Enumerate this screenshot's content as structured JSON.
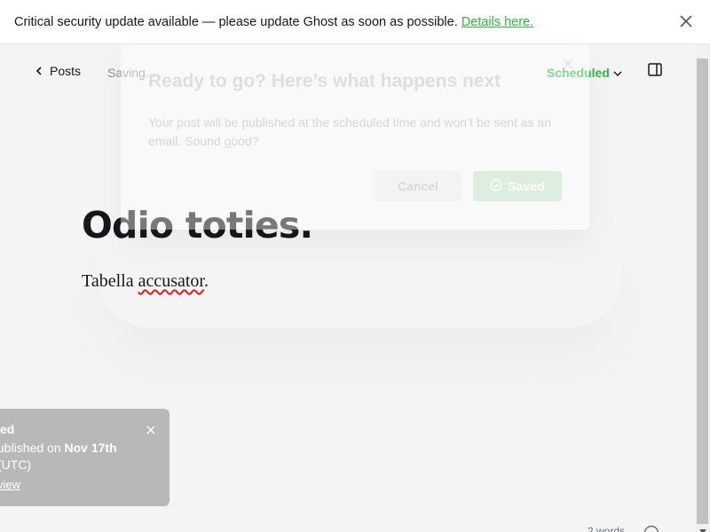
{
  "alert": {
    "message": "Critical security update available — please update Ghost as soon as possible.",
    "link_text": "Details here."
  },
  "header": {
    "back_label": "Posts",
    "saving_label": "Saving...",
    "status_label": "Scheduled"
  },
  "post": {
    "title": "Odio toties.",
    "body_word1": "Tabella ",
    "body_word2": "accusator",
    "body_end": "."
  },
  "modal": {
    "title": "Ready to go? Here’s what happens next",
    "description": "Your post will be published at the scheduled time and won’t be sent as an email. Sound good?",
    "cancel_label": "Cancel",
    "saved_label": "Saved"
  },
  "toast": {
    "title": "ed",
    "line1_prefix": "ublished on ",
    "line1_date": "Nov 17th",
    "line2": "(UTC)",
    "link_text": "view"
  },
  "footer": {
    "word_count": "2 words"
  },
  "colors": {
    "accent_green": "#30b848",
    "toast_bg": "#b8b8b8",
    "page_bg": "#f4f4f4"
  }
}
